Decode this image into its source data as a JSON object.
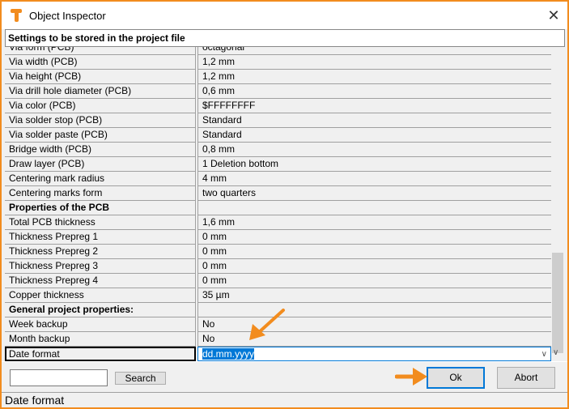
{
  "window": {
    "title": "Object Inspector",
    "close": "✕"
  },
  "header": "Settings to be stored in the project file",
  "rows": [
    {
      "name": "Via form (PCB)",
      "value": "octagonal"
    },
    {
      "name": "Via width (PCB)",
      "value": "1,2 mm"
    },
    {
      "name": "Via height (PCB)",
      "value": "1,2 mm"
    },
    {
      "name": "Via drill hole diameter (PCB)",
      "value": "0,6 mm"
    },
    {
      "name": "Via color (PCB)",
      "value": "$FFFFFFFF"
    },
    {
      "name": "Via solder stop (PCB)",
      "value": "Standard"
    },
    {
      "name": "Via solder paste (PCB)",
      "value": "Standard"
    },
    {
      "name": "Bridge width (PCB)",
      "value": "0,8 mm"
    },
    {
      "name": "Draw layer (PCB)",
      "value": "1 Deletion bottom"
    },
    {
      "name": "Centering mark radius",
      "value": "4 mm"
    },
    {
      "name": "Centering marks form",
      "value": "two quarters"
    },
    {
      "name": "Properties of the PCB",
      "value": "",
      "section": true
    },
    {
      "name": "Total PCB thickness",
      "value": "1,6 mm"
    },
    {
      "name": "Thickness Prepreg 1",
      "value": "0 mm"
    },
    {
      "name": "Thickness Prepreg 2",
      "value": "0 mm"
    },
    {
      "name": "Thickness Prepreg 3",
      "value": "0 mm"
    },
    {
      "name": "Thickness Prepreg 4",
      "value": "0 mm"
    },
    {
      "name": "Copper thickness",
      "value": "35 µm"
    },
    {
      "name": "General project properties:",
      "value": "",
      "section": true
    },
    {
      "name": "Week backup",
      "value": "No"
    },
    {
      "name": "Month backup",
      "value": "No"
    },
    {
      "name": "Date format",
      "value": "dd.mm.yyyy",
      "selected": true
    }
  ],
  "search": {
    "value": "",
    "button": "Search"
  },
  "buttons": {
    "ok": "Ok",
    "abort": "Abort"
  },
  "status": "Date format",
  "colors": {
    "accent": "#f28c1e",
    "selection": "#0078d7"
  }
}
